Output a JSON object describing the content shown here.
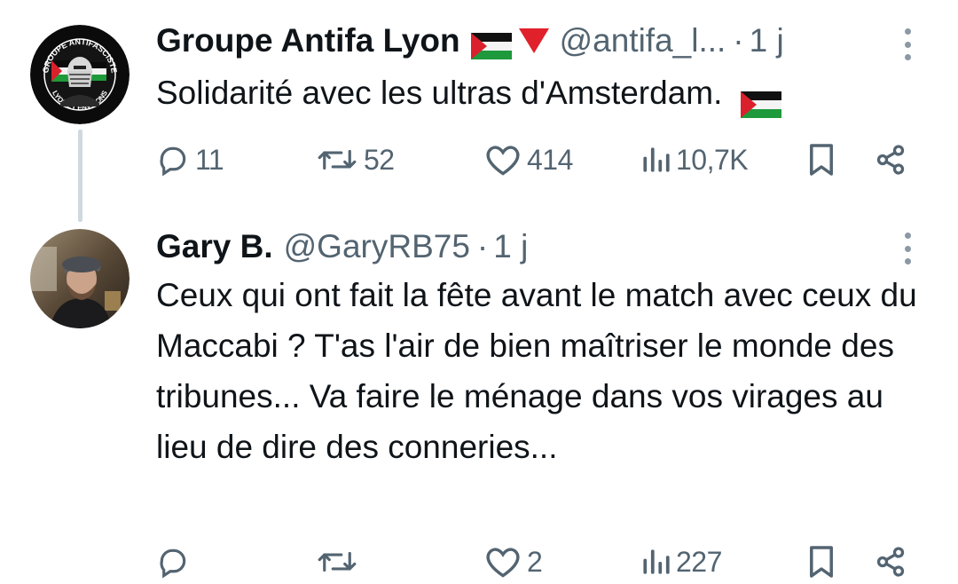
{
  "tweets": [
    {
      "name": "Groupe Antifa Lyon",
      "handle": "@antifa_l...",
      "dot": "·",
      "time": "1 j",
      "text": "Solidarité avec les ultras d'Amsterdam.",
      "avatar_text_top": "GROUPE ANTIFASCISTE",
      "avatar_text_bottom": "LYON ET ENVIRONS",
      "name_badges": [
        "palestine-flag-icon",
        "red-triangle-icon"
      ],
      "text_badges": [
        "palestine-flag-icon"
      ],
      "stats": {
        "replies": "11",
        "reposts": "52",
        "likes": "414",
        "views": "10,7K"
      }
    },
    {
      "name": "Gary B.",
      "handle": "@GaryRB75",
      "dot": "·",
      "time": "1 j",
      "text": "Ceux qui ont fait la fête avant le match avec ceux du Maccabi ? T'as l'air de bien maîtriser le monde des tribunes... Va faire le ménage dans vos virages au lieu de dire des conneries...",
      "stats": {
        "replies": "",
        "reposts": "",
        "likes": "2",
        "views": "227"
      }
    }
  ],
  "colors": {
    "text": "#0f1419",
    "secondary": "#536471",
    "thread_line": "#cfd9de",
    "triangle": "#e0202b"
  }
}
